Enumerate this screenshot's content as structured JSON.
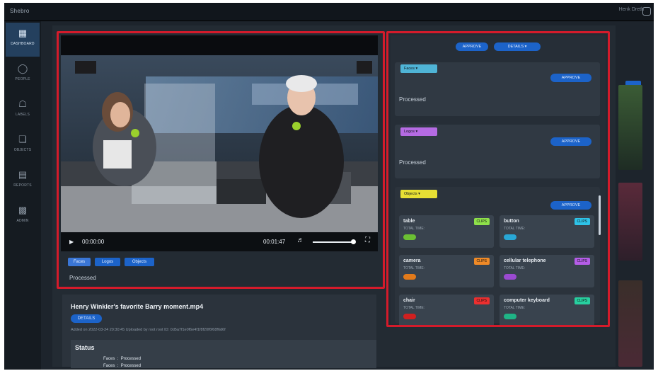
{
  "app": {
    "title": "Shebro",
    "user_label": "Henk Dreth"
  },
  "sidebar": {
    "items": [
      {
        "label": "DASHBOARD",
        "icon": "grid-icon"
      },
      {
        "label": "PEOPLE",
        "icon": "person-icon"
      },
      {
        "label": "LABELS",
        "icon": "tag-icon"
      },
      {
        "label": "OBJECTS",
        "icon": "cube-icon"
      },
      {
        "label": "REPORTS",
        "icon": "bar-chart-icon"
      },
      {
        "label": "ADMIN",
        "icon": "building-icon"
      }
    ]
  },
  "player": {
    "current_time": "00:00:00",
    "duration": "00:01:47",
    "volume": 0.9
  },
  "tag_tabs": [
    "Faces",
    "Logos",
    "Objects"
  ],
  "left_status": "Processed",
  "video": {
    "title": "Henry Winkler's favorite Barry moment.mp4",
    "details_label": "DETAILS",
    "meta": "Added on 2022-03-24 20:30:45   Uploaded by root root   ID: 0d5a7f1e0f6e4f1f8f20f6f68f6d6f"
  },
  "status": {
    "title": "Status",
    "rows": [
      {
        "key": "Faces",
        "sep": ":",
        "value": "Processed"
      },
      {
        "key": "Faces",
        "sep": ":",
        "value": "Processed"
      }
    ]
  },
  "review": {
    "approve_label": "APPROVE",
    "dropdown_label": "DETAILS ▾",
    "groups": [
      {
        "tag": "Faces ▾",
        "tag_color": "#4fb4d6",
        "button": "APPROVE",
        "status": "Processed"
      },
      {
        "tag": "Logos ▾",
        "tag_color": "#b56be3",
        "button": "APPROVE",
        "status": "Processed"
      },
      {
        "tag": "Objects ▾",
        "tag_color": "#e7e034",
        "button": "APPROVE",
        "status": ""
      }
    ],
    "objects": [
      {
        "name": "table",
        "total_time": "TOTAL TIME:",
        "clips": "CLIPS",
        "clip_color": "#8ee04a",
        "dur_color": "#6bbf33"
      },
      {
        "name": "button",
        "total_time": "TOTAL TIME:",
        "clips": "CLIPS",
        "clip_color": "#2ec3e8",
        "dur_color": "#28a7d6"
      },
      {
        "name": "camera",
        "total_time": "TOTAL TIME:",
        "clips": "CLIPS",
        "clip_color": "#f08a27",
        "dur_color": "#e27a1a"
      },
      {
        "name": "cellular telephone",
        "total_time": "TOTAL TIME:",
        "clips": "CLIPS",
        "clip_color": "#b55de8",
        "dur_color": "#9b4ad1"
      },
      {
        "name": "chair",
        "total_time": "TOTAL TIME:",
        "clips": "CLIPS",
        "clip_color": "#ec2f2f",
        "dur_color": "#d02020"
      },
      {
        "name": "computer keyboard",
        "total_time": "TOTAL TIME:",
        "clips": "CLIPS",
        "clip_color": "#27d0a0",
        "dur_color": "#1fb486"
      }
    ]
  }
}
